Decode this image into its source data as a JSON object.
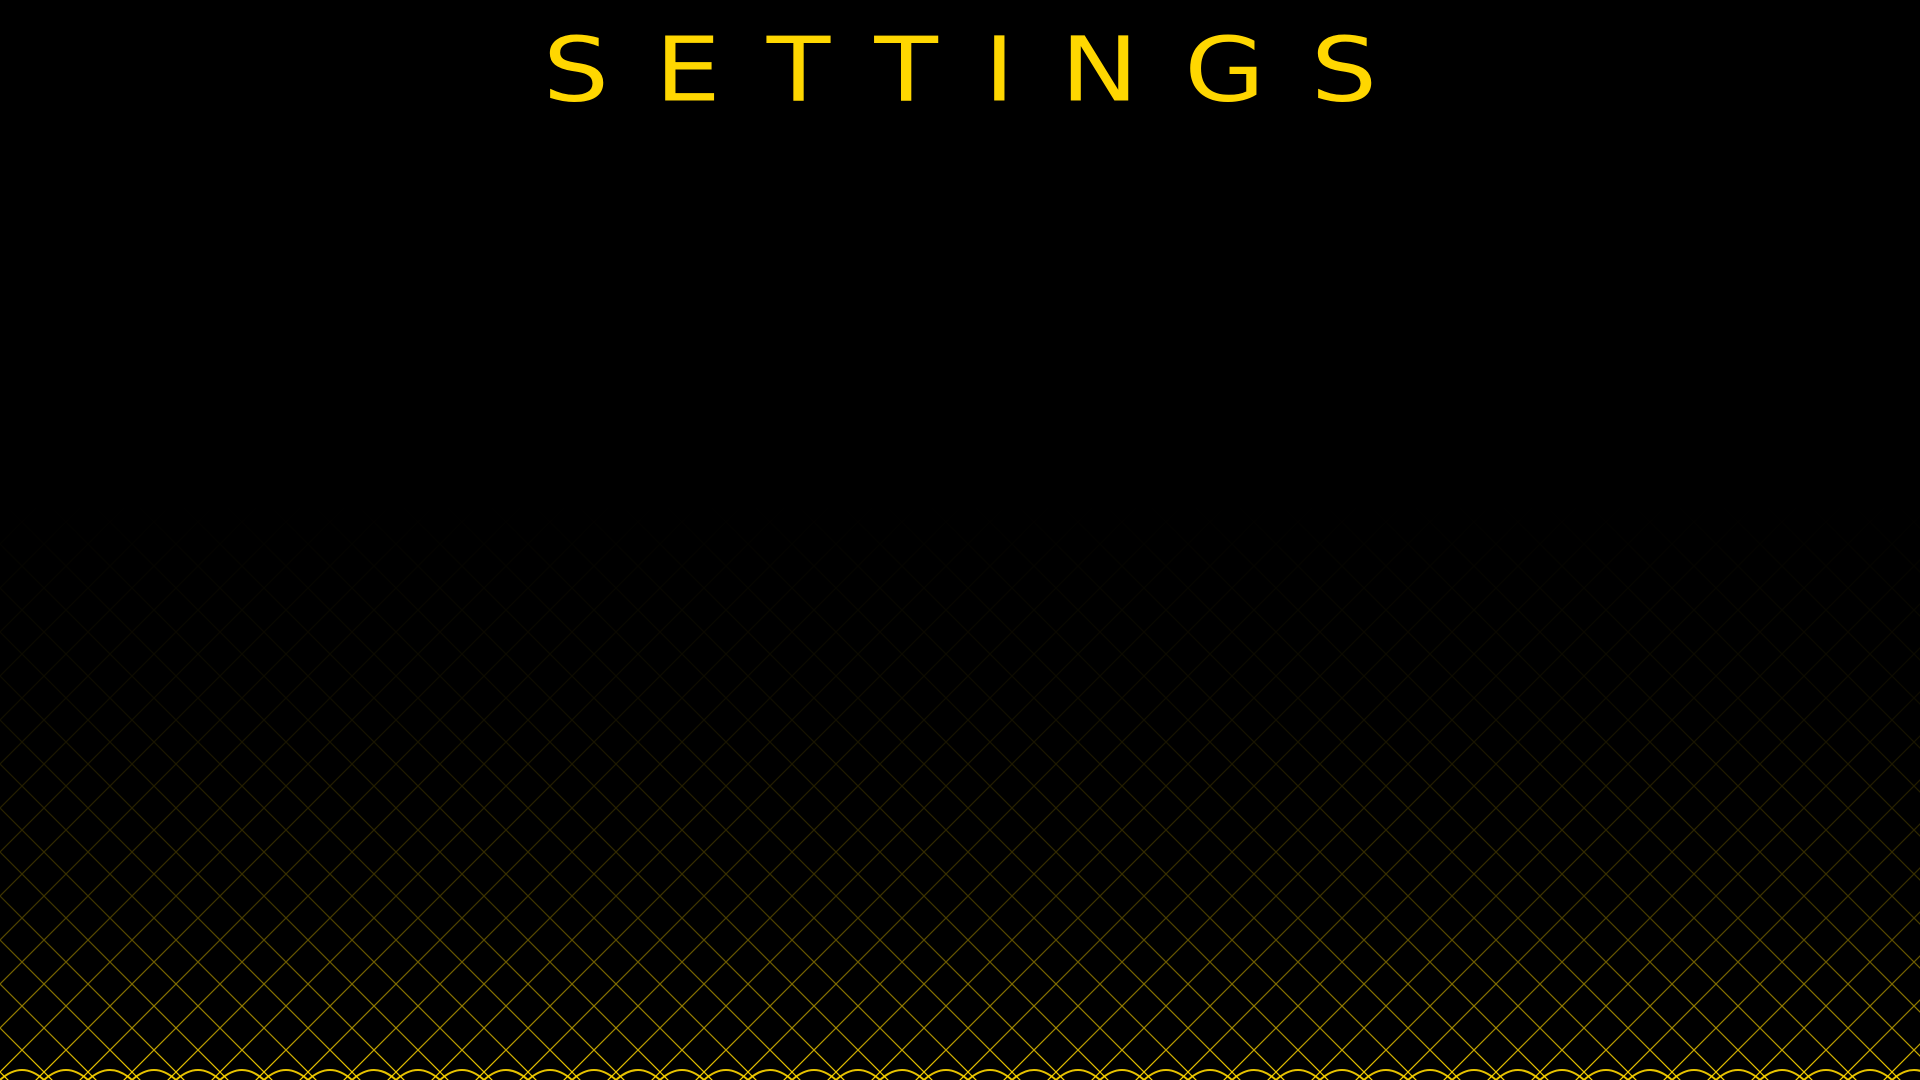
{
  "screen": {
    "title": "SETTINGS"
  },
  "colors": {
    "background": "#000000",
    "accent": "#FFD700"
  },
  "decoration": {
    "name": "diamond-grid-pattern"
  }
}
